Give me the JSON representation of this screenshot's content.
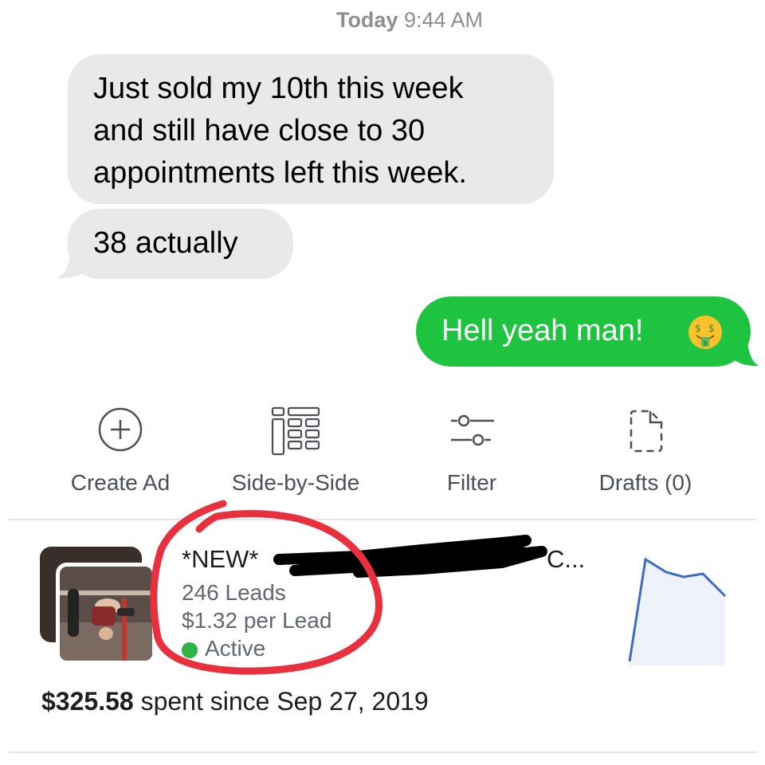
{
  "conversation": {
    "timestamp": {
      "day": "Today",
      "time": "9:44 AM"
    },
    "incoming": [
      {
        "lines": [
          "Just sold my 10th this week",
          "and still have close to 30",
          "appointments left this week."
        ]
      },
      {
        "lines": [
          "38 actually"
        ]
      }
    ],
    "outgoing": [
      {
        "text": "Hell yeah man!",
        "emoji": "money-mouth-face"
      }
    ],
    "colors": {
      "incoming_bg": "#e9e9eb",
      "outgoing_bg": "#1ec33f"
    }
  },
  "toolbar": {
    "items": [
      {
        "label": "Create Ad",
        "icon": "plus-circle-icon"
      },
      {
        "label": "Side-by-Side",
        "icon": "side-by-side-grid-icon"
      },
      {
        "label": "Filter",
        "icon": "filter-sliders-icon"
      },
      {
        "label": "Drafts (0)",
        "icon": "draft-document-icon"
      }
    ]
  },
  "ad": {
    "title_prefix": "*NEW*",
    "title_suffix": "C...",
    "leads": "246 Leads",
    "cost_per_lead": "$1.32 per Lead",
    "status": "Active",
    "status_color": "#2fb344",
    "spent_amount": "$325.58",
    "spent_suffix": "spent since Sep 27, 2019",
    "annotation_color": "#e8303f",
    "sparkline": {
      "color": "#3f6bc4",
      "fill": "#eef2fb"
    }
  }
}
